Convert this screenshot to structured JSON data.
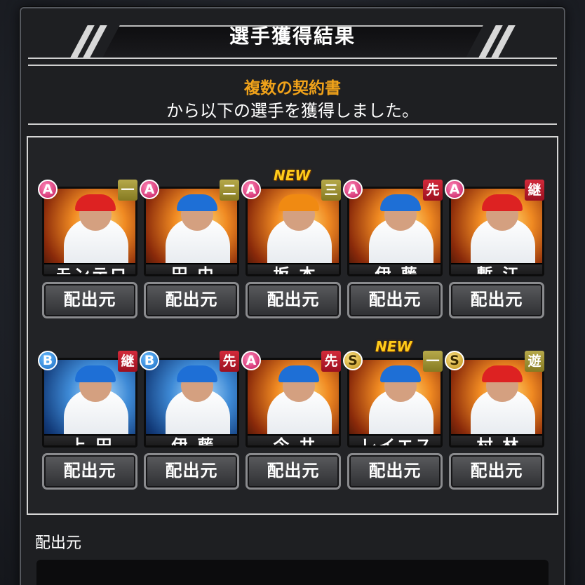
{
  "header": {
    "title": "選手獲得結果"
  },
  "message": {
    "highlight": "複数の契約書",
    "body": "から以下の選手を獲得しました。"
  },
  "players": [
    {
      "name": "モンテロ",
      "rank": "A",
      "position": "一",
      "pos_color": "gold",
      "new": false,
      "team_color": "#d22",
      "bg": "orange",
      "button": "配出元"
    },
    {
      "name": "田 中",
      "rank": "A",
      "position": "二",
      "pos_color": "gold",
      "new": false,
      "team_color": "#1e6fd6",
      "bg": "orange",
      "button": "配出元"
    },
    {
      "name": "坂 本",
      "rank": "A",
      "position": "三",
      "pos_color": "gold",
      "new": true,
      "team_color": "#f08a12",
      "bg": "orange",
      "button": "配出元"
    },
    {
      "name": "伊 藤",
      "rank": "A",
      "position": "先",
      "pos_color": "red",
      "new": false,
      "team_color": "#1e6fd6",
      "bg": "orange",
      "button": "配出元"
    },
    {
      "name": "塹 江",
      "rank": "A",
      "position": "継",
      "pos_color": "red",
      "new": false,
      "team_color": "#d22",
      "bg": "orange",
      "button": "配出元"
    },
    {
      "name": "上 田",
      "rank": "B",
      "position": "継",
      "pos_color": "red",
      "new": false,
      "team_color": "#1e6fd6",
      "bg": "blue",
      "button": "配出元"
    },
    {
      "name": "伊 藤",
      "rank": "B",
      "position": "先",
      "pos_color": "red",
      "new": false,
      "team_color": "#1e6fd6",
      "bg": "blue",
      "button": "配出元"
    },
    {
      "name": "今 井",
      "rank": "A",
      "position": "先",
      "pos_color": "red",
      "new": false,
      "team_color": "#1e6fd6",
      "bg": "orange",
      "button": "配出元"
    },
    {
      "name": "レイエス",
      "rank": "S",
      "position": "一",
      "pos_color": "gold",
      "new": true,
      "team_color": "#1e6fd6",
      "bg": "orange",
      "button": "配出元"
    },
    {
      "name": "村 林",
      "rank": "S",
      "position": "遊",
      "pos_color": "gold",
      "new": false,
      "team_color": "#d22",
      "bg": "orange",
      "button": "配出元"
    }
  ],
  "new_label": "NEW",
  "source": {
    "label": "配出元"
  }
}
